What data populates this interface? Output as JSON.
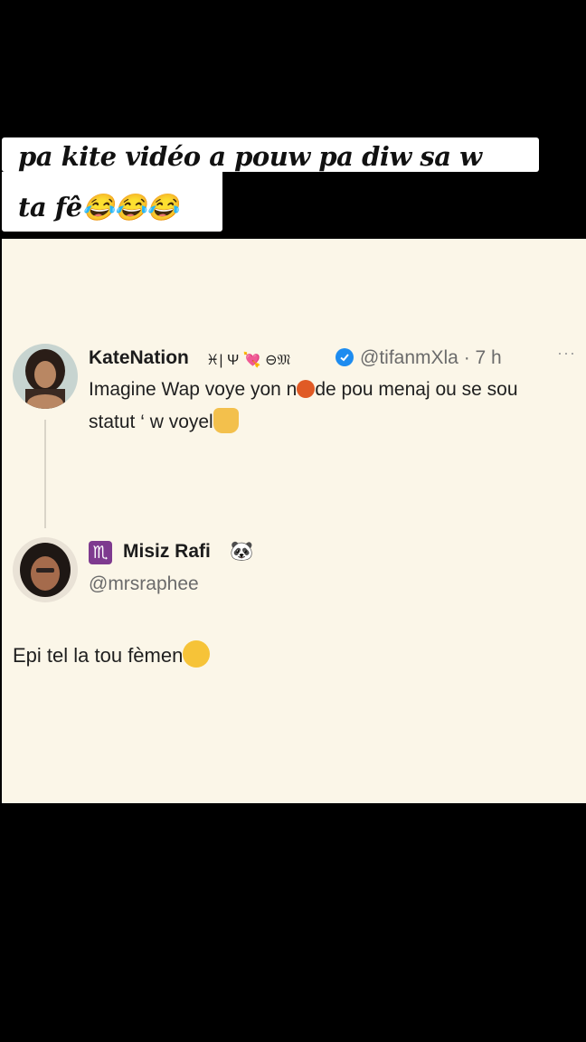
{
  "caption": {
    "line1": "pa kite vidéo a pouw pa diw sa w",
    "line2": "ta fê😂😂😂"
  },
  "tweet": {
    "display_name": "KateNation",
    "name_symbols": "♓| Ψ 💘 ⊖𝔐",
    "handle_time": "@tifanmXla · 7 h",
    "more": "···",
    "text_line1_pre": "Imagine Wap voye yon n",
    "text_line1_post": "de pou menaj ou se sou",
    "text_line2": "statut ‘ w voyel"
  },
  "reply": {
    "zodiac": "♏",
    "display_name": "Misiz Rafi",
    "emoji": "🐼",
    "handle": "@mrsraphee",
    "text": "Epi tel la tou fèmen"
  },
  "colors": {
    "card_background": "#fbf6e8",
    "verified": "#1d8cf0",
    "zodiac_badge": "#7e3a8f"
  }
}
